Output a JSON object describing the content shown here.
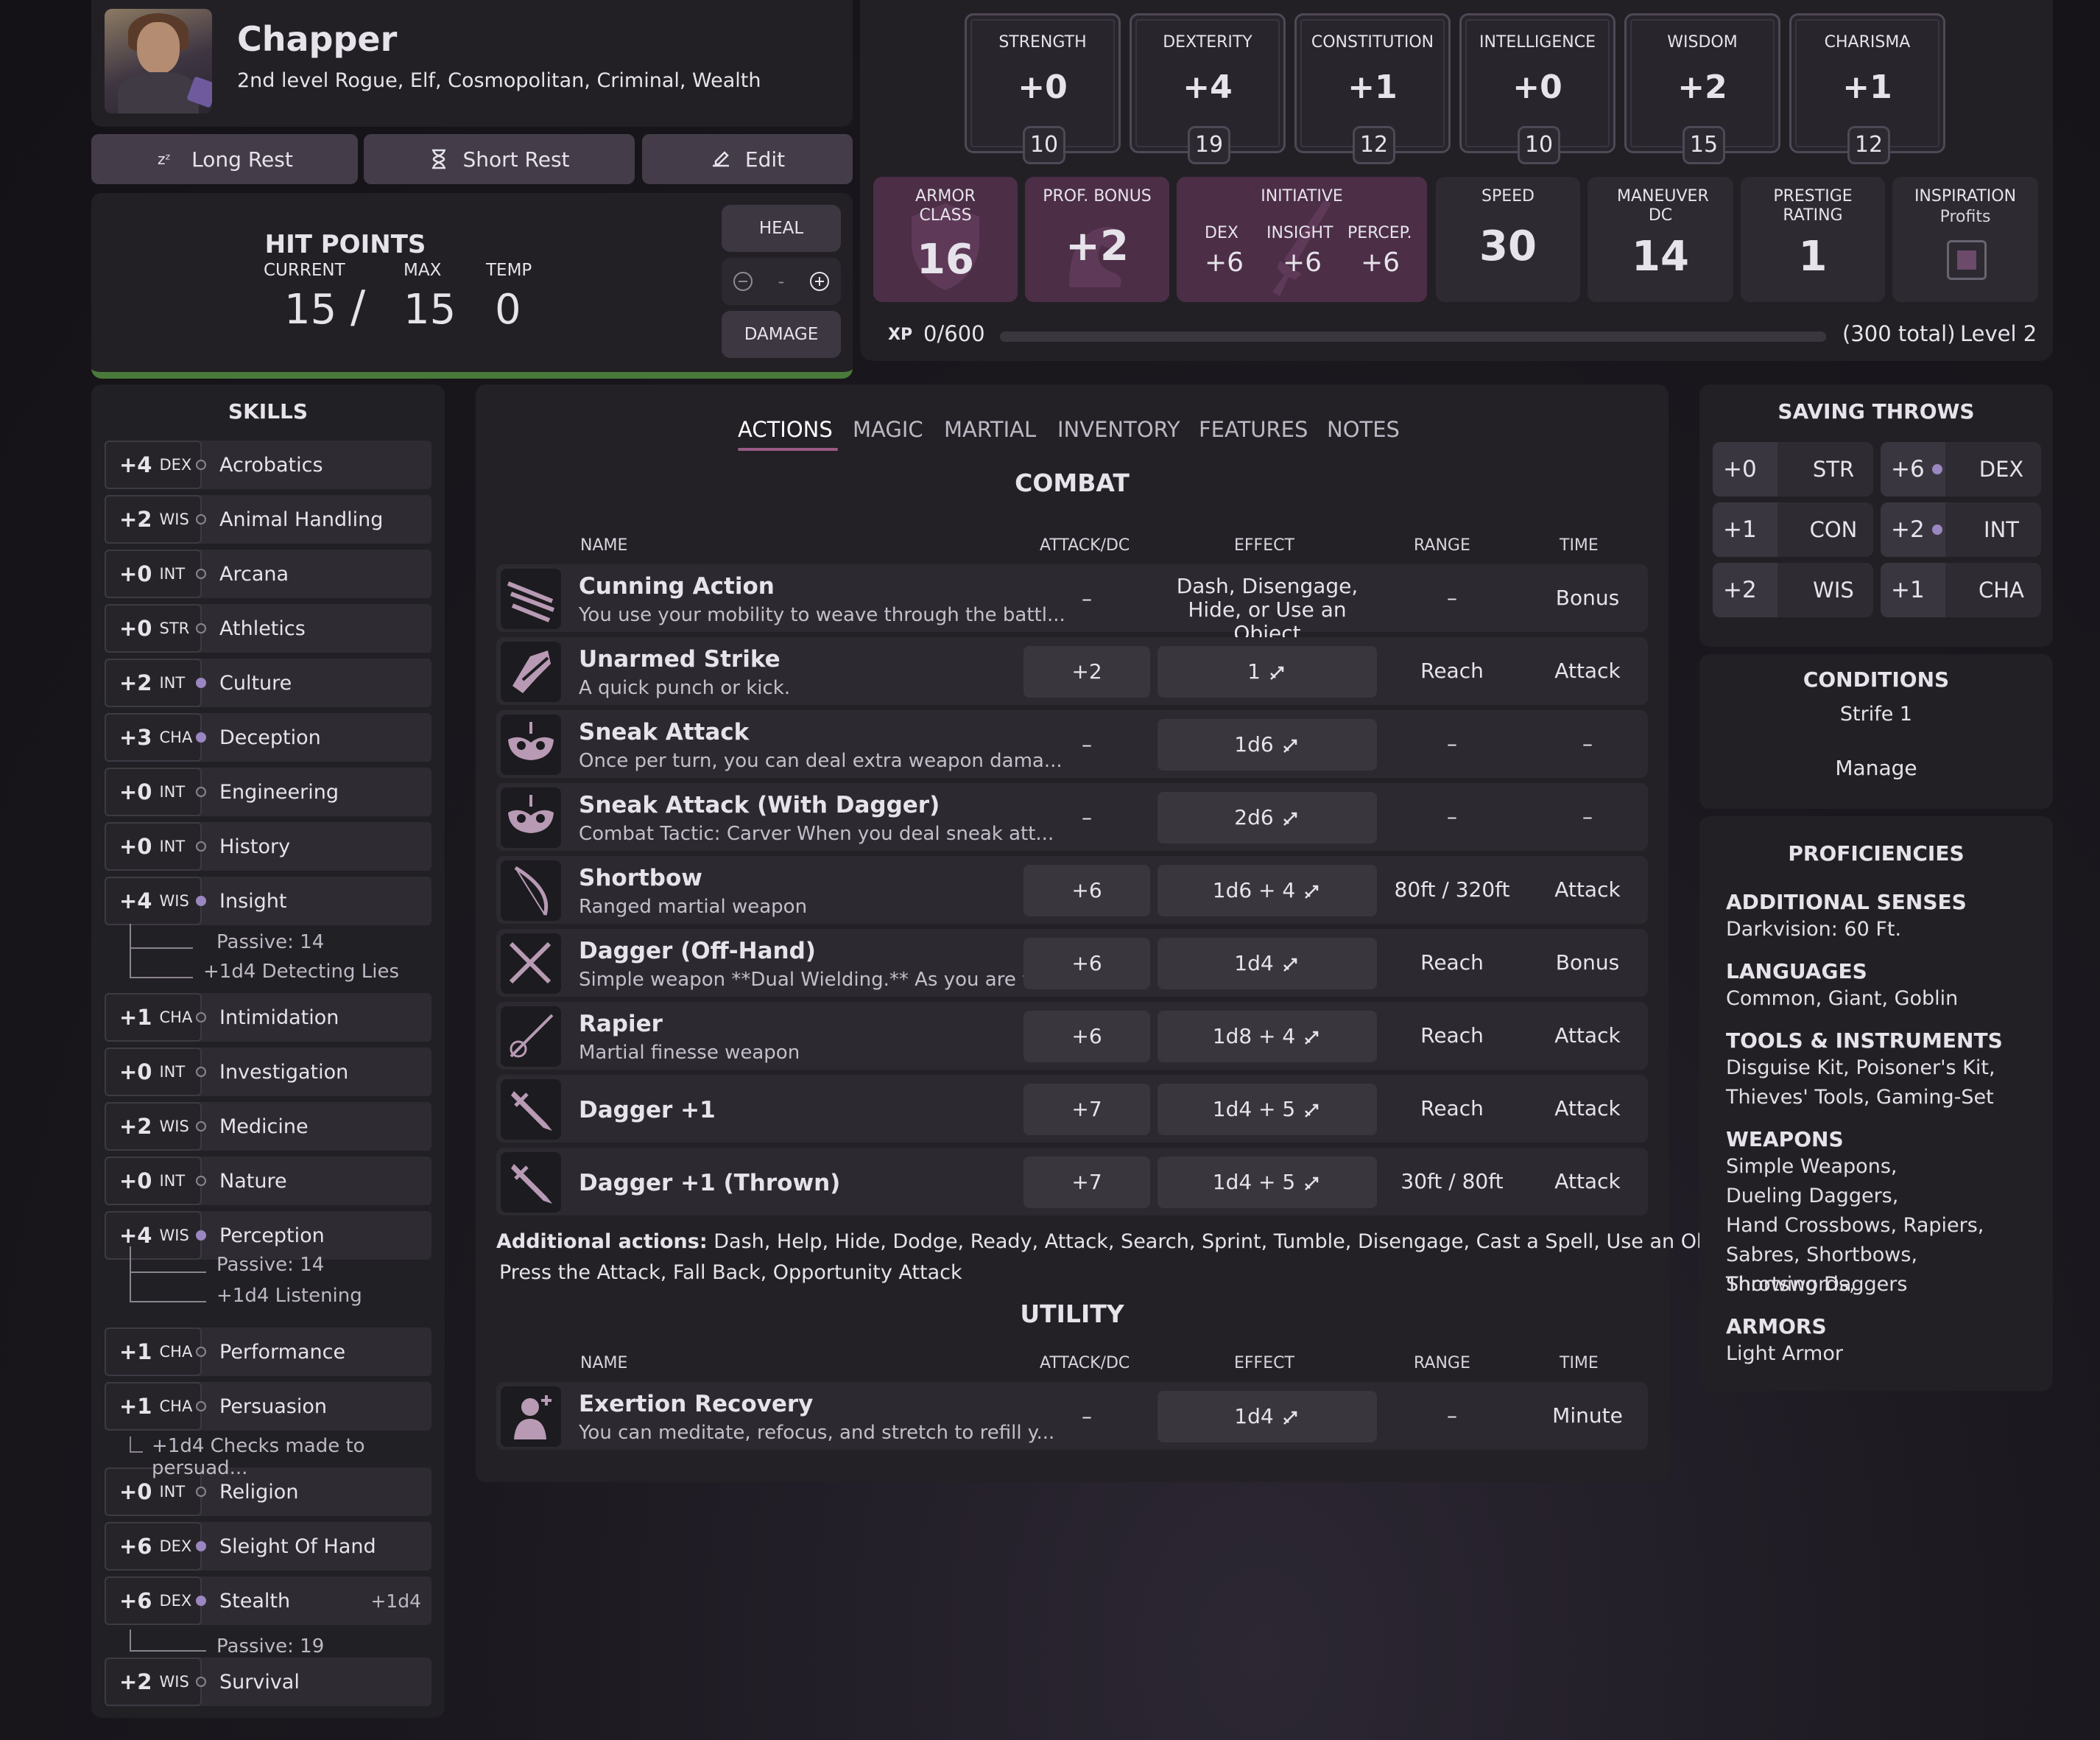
{
  "header": {
    "name": "Chapper",
    "subtitle": "2nd level Rogue, Elf, Cosmopolitan, Criminal, Wealth",
    "long_rest": "Long Rest",
    "short_rest": "Short Rest",
    "edit": "Edit"
  },
  "hit_points": {
    "title": "HIT POINTS",
    "current_label": "CURRENT",
    "max_label": "MAX",
    "temp_label": "TEMP",
    "current": "15",
    "slash": "/",
    "max": "15",
    "temp": "0",
    "heal": "HEAL",
    "damage": "DAMAGE",
    "stepper_value": "-"
  },
  "abilities": [
    {
      "name": "STRENGTH",
      "mod": "+0",
      "score": "10"
    },
    {
      "name": "DEXTERITY",
      "mod": "+4",
      "score": "19"
    },
    {
      "name": "CONSTITUTION",
      "mod": "+1",
      "score": "12"
    },
    {
      "name": "INTELLIGENCE",
      "mod": "+0",
      "score": "10"
    },
    {
      "name": "WISDOM",
      "mod": "+2",
      "score": "15"
    },
    {
      "name": "CHARISMA",
      "mod": "+1",
      "score": "12"
    }
  ],
  "stats": {
    "ac_label": "ARMOR CLASS",
    "ac": "16",
    "prof_label": "PROF. BONUS",
    "prof": "+2",
    "init_label": "INITIATIVE",
    "init_dex_label": "DEX",
    "init_dex": "+6",
    "init_insight_label": "INSIGHT",
    "init_insight": "+6",
    "init_percep_label": "PERCEP.",
    "init_percep": "+6",
    "speed_label": "SPEED",
    "speed": "30",
    "maneuver_label": "MANEUVER DC",
    "maneuver": "14",
    "prestige_label": "PRESTIGE RATING",
    "prestige": "1",
    "inspiration_label": "INSPIRATION",
    "inspiration_sub": "Profits"
  },
  "xp": {
    "label": "XP",
    "value": "0/600",
    "progress": 0,
    "total": "(300 total)",
    "level": "Level 2"
  },
  "skills": {
    "title": "SKILLS",
    "items": [
      {
        "mod": "+4",
        "abbr": "DEX",
        "name": "Acrobatics",
        "prof": false
      },
      {
        "mod": "+2",
        "abbr": "WIS",
        "name": "Animal Handling",
        "prof": false
      },
      {
        "mod": "+0",
        "abbr": "INT",
        "name": "Arcana",
        "prof": false
      },
      {
        "mod": "+0",
        "abbr": "STR",
        "name": "Athletics",
        "prof": false
      },
      {
        "mod": "+2",
        "abbr": "INT",
        "name": "Culture",
        "prof": true
      },
      {
        "mod": "+3",
        "abbr": "CHA",
        "name": "Deception",
        "prof": true
      },
      {
        "mod": "+0",
        "abbr": "INT",
        "name": "Engineering",
        "prof": false
      },
      {
        "mod": "+0",
        "abbr": "INT",
        "name": "History",
        "prof": false
      },
      {
        "mod": "+4",
        "abbr": "WIS",
        "name": "Insight",
        "prof": true
      },
      {
        "mod": "+1",
        "abbr": "CHA",
        "name": "Intimidation",
        "prof": false
      },
      {
        "mod": "+0",
        "abbr": "INT",
        "name": "Investigation",
        "prof": false
      },
      {
        "mod": "+2",
        "abbr": "WIS",
        "name": "Medicine",
        "prof": false
      },
      {
        "mod": "+0",
        "abbr": "INT",
        "name": "Nature",
        "prof": false
      },
      {
        "mod": "+4",
        "abbr": "WIS",
        "name": "Perception",
        "prof": true
      },
      {
        "mod": "+1",
        "abbr": "CHA",
        "name": "Performance",
        "prof": false
      },
      {
        "mod": "+1",
        "abbr": "CHA",
        "name": "Persuasion",
        "prof": false
      },
      {
        "mod": "+0",
        "abbr": "INT",
        "name": "Religion",
        "prof": false
      },
      {
        "mod": "+6",
        "abbr": "DEX",
        "name": "Sleight Of Hand",
        "prof": true
      },
      {
        "mod": "+6",
        "abbr": "DEX",
        "name": "Stealth",
        "prof": true,
        "extra": "+1d4"
      },
      {
        "mod": "+2",
        "abbr": "WIS",
        "name": "Survival",
        "prof": false
      }
    ],
    "insight_passive": "Passive: 14",
    "insight_bonus": "+1d4 Detecting Lies",
    "perception_passive": "Passive: 14",
    "perception_bonus": "+1d4 Listening",
    "persuasion_bonus": "+1d4 Checks made to persuad...",
    "stealth_passive": "Passive: 19"
  },
  "tabs": [
    "ACTIONS",
    "MAGIC",
    "MARTIAL",
    "INVENTORY",
    "FEATURES",
    "NOTES"
  ],
  "combat": {
    "title": "COMBAT",
    "headers": {
      "name": "NAME",
      "attack": "ATTACK/DC",
      "effect": "EFFECT",
      "range": "RANGE",
      "time": "TIME"
    },
    "rows": [
      {
        "name": "Cunning Action",
        "desc": "You use your mobility to weave through the battl...",
        "attack": "–",
        "effect": "Dash, Disengage, Hide, or Use an Object",
        "range": "–",
        "time": "Bonus Action"
      },
      {
        "name": "Unarmed Strike",
        "desc": "A quick punch or kick.",
        "attack": "+2",
        "effect": "1",
        "range": "Reach",
        "time": "Attack"
      },
      {
        "name": "Sneak Attack",
        "desc": "Once per turn, you can deal extra weapon dama...",
        "attack": "–",
        "effect": "1d6",
        "range": "–",
        "time": "–"
      },
      {
        "name": "Sneak Attack (With Dagger)",
        "desc": "Combat Tactic: Carver When you deal sneak att...",
        "attack": "–",
        "effect": "2d6",
        "range": "–",
        "time": "–"
      },
      {
        "name": "Shortbow",
        "desc": "Ranged martial weapon",
        "attack": "+6",
        "effect": "1d6 + 4",
        "range": "80ft / 320ft",
        "time": "Attack"
      },
      {
        "name": "Dagger (Off-Hand)",
        "desc": "Simple weapon **Dual Wielding.** As you are wi...",
        "attack": "+6",
        "effect": "1d4",
        "range": "Reach",
        "time": "Bonus Action"
      },
      {
        "name": "Rapier",
        "desc": "Martial finesse weapon",
        "attack": "+6",
        "effect": "1d8 + 4",
        "range": "Reach",
        "time": "Attack"
      },
      {
        "name": "Dagger +1",
        "desc": "",
        "attack": "+7",
        "effect": "1d4 + 5",
        "range": "Reach",
        "time": "Attack"
      },
      {
        "name": "Dagger +1 (Thrown)",
        "desc": "",
        "attack": "+7",
        "effect": "1d4 + 5",
        "range": "30ft / 80ft",
        "time": "Attack"
      }
    ],
    "additional_label": "Additional actions:",
    "additional_line1": "Dash, Help, Hide, Dodge, Ready, Attack, Search, Sprint, Tumble, Disengage, Cast a Spell, Use an Object,",
    "additional_line2": "Press the Attack, Fall Back, Opportunity Attack"
  },
  "utility": {
    "title": "UTILITY",
    "rows": [
      {
        "name": "Exertion Recovery",
        "desc": "You can meditate, refocus, and stretch to refill y...",
        "attack": "–",
        "effect": "1d4",
        "range": "–",
        "time": "Minute"
      }
    ]
  },
  "saving_throws": {
    "title": "SAVING THROWS",
    "items": [
      {
        "mod": "+0",
        "name": "STR",
        "prof": false
      },
      {
        "mod": "+6",
        "name": "DEX",
        "prof": true
      },
      {
        "mod": "+1",
        "name": "CON",
        "prof": false
      },
      {
        "mod": "+2",
        "name": "INT",
        "prof": true
      },
      {
        "mod": "+2",
        "name": "WIS",
        "prof": false
      },
      {
        "mod": "+1",
        "name": "CHA",
        "prof": false
      }
    ]
  },
  "conditions": {
    "title": "CONDITIONS",
    "value": "Strife 1",
    "manage": "Manage"
  },
  "proficiencies": {
    "title": "PROFICIENCIES",
    "senses_label": "ADDITIONAL SENSES",
    "senses": "Darkvision: 60 Ft.",
    "languages_label": "LANGUAGES",
    "languages": "Common, Giant, Goblin",
    "tools_label": "TOOLS & INSTRUMENTS",
    "tools": [
      "Disguise Kit, Poisoner's Kit,",
      "Thieves' Tools, Gaming-Set"
    ],
    "weapons_label": "WEAPONS",
    "weapons": [
      "Simple Weapons,",
      "Dueling Daggers,",
      "Hand Crossbows, Rapiers,",
      "Sabres, Shortbows, Shortswords,",
      "Throwing Daggers"
    ],
    "armors_label": "ARMORS",
    "armors": "Light Armor"
  },
  "colors": {
    "accent": "#8a4a7a",
    "stat_purple": "#4c2e47",
    "hp_bar": "#4a7a3a"
  }
}
